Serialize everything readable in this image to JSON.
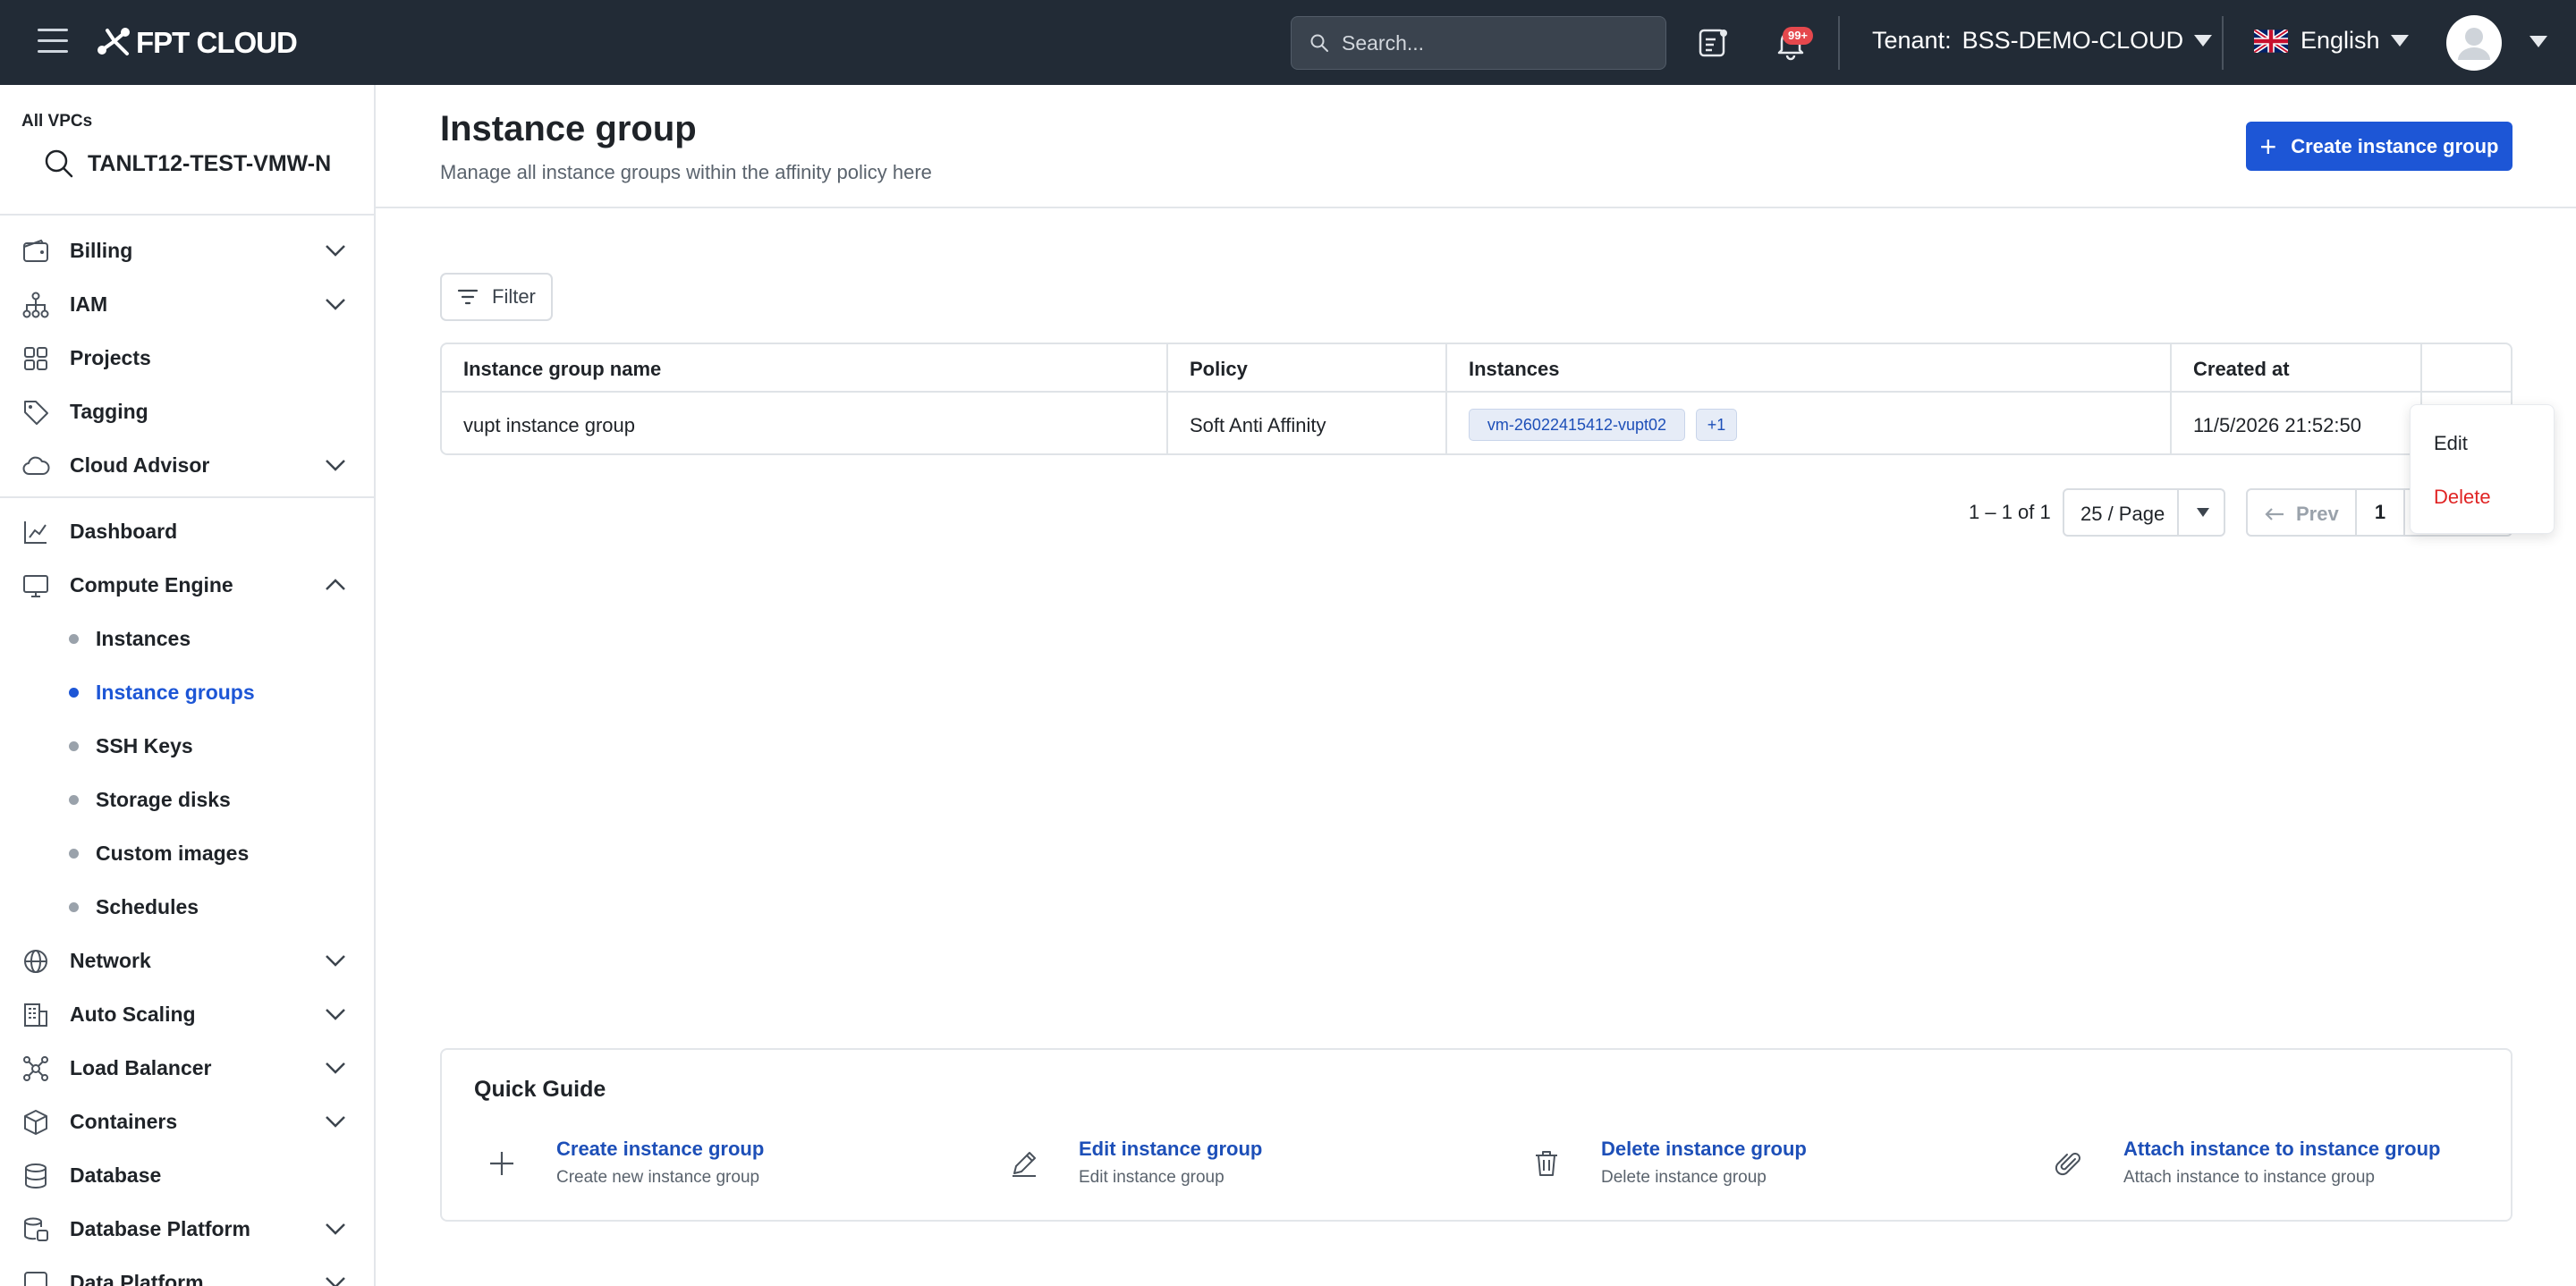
{
  "topbar": {
    "logo_text": "FPT CLOUD",
    "search_placeholder": "Search...",
    "notification_count": "99+",
    "tenant_label": "Tenant:",
    "tenant_value": "BSS-DEMO-CLOUD",
    "language": "English"
  },
  "sidebar": {
    "vpc_label": "All VPCs",
    "vpc_name": "TANLT12-TEST-VMW-N",
    "items": [
      {
        "label": "Billing",
        "icon": "wallet-icon"
      },
      {
        "label": "IAM",
        "icon": "hierarchy-icon"
      },
      {
        "label": "Projects",
        "icon": "grid-icon"
      },
      {
        "label": "Tagging",
        "icon": "tag-icon"
      },
      {
        "label": "Cloud Advisor",
        "icon": "cloud-icon"
      },
      {
        "label": "Dashboard",
        "icon": "chart-icon"
      },
      {
        "label": "Compute Engine",
        "icon": "monitor-icon"
      },
      {
        "label": "Network",
        "icon": "globe-icon"
      },
      {
        "label": "Auto Scaling",
        "icon": "building-icon"
      },
      {
        "label": "Load Balancer",
        "icon": "network-icon"
      },
      {
        "label": "Containers",
        "icon": "cube-icon"
      },
      {
        "label": "Database",
        "icon": "database-icon"
      },
      {
        "label": "Database Platform",
        "icon": "database-stack-icon"
      },
      {
        "label": "Data Platform",
        "icon": "data-icon"
      }
    ],
    "compute_sub": [
      {
        "label": "Instances"
      },
      {
        "label": "Instance groups"
      },
      {
        "label": "SSH Keys"
      },
      {
        "label": "Storage disks"
      },
      {
        "label": "Custom images"
      },
      {
        "label": "Schedules"
      }
    ],
    "active_sub": "Instance groups",
    "accent_color": "#1d56d6"
  },
  "main": {
    "title": "Instance group",
    "subtitle": "Manage all instance groups within the affinity policy here",
    "create_label": "Create instance group",
    "filter_label": "Filter",
    "table": {
      "headers": [
        "Instance group name",
        "Policy",
        "Instances",
        "Created at"
      ],
      "rows": [
        {
          "name": "vupt instance group",
          "policy": "Soft Anti Affinity",
          "instance_chip": "vm-26022415412-vupt02",
          "more_chip": "+1",
          "created": "11/5/2026 21:52:50"
        }
      ]
    },
    "pagination": {
      "range": "1 – 1 of 1",
      "page_size": "25 / Page",
      "prev": "Prev",
      "current": "1"
    },
    "context_menu": {
      "edit": "Edit",
      "delete": "Delete",
      "delete_color": "#e02424"
    },
    "quick_guide": {
      "title": "Quick Guide",
      "items": [
        {
          "title": "Create instance group",
          "desc": "Create new instance group",
          "icon": "plus-icon"
        },
        {
          "title": "Edit instance group",
          "desc": "Edit instance group",
          "icon": "pencil-icon"
        },
        {
          "title": "Delete instance group",
          "desc": "Delete instance group",
          "icon": "trash-icon"
        },
        {
          "title": "Attach instance to instance group",
          "desc": "Attach instance to instance group",
          "icon": "paperclip-icon"
        }
      ]
    }
  }
}
